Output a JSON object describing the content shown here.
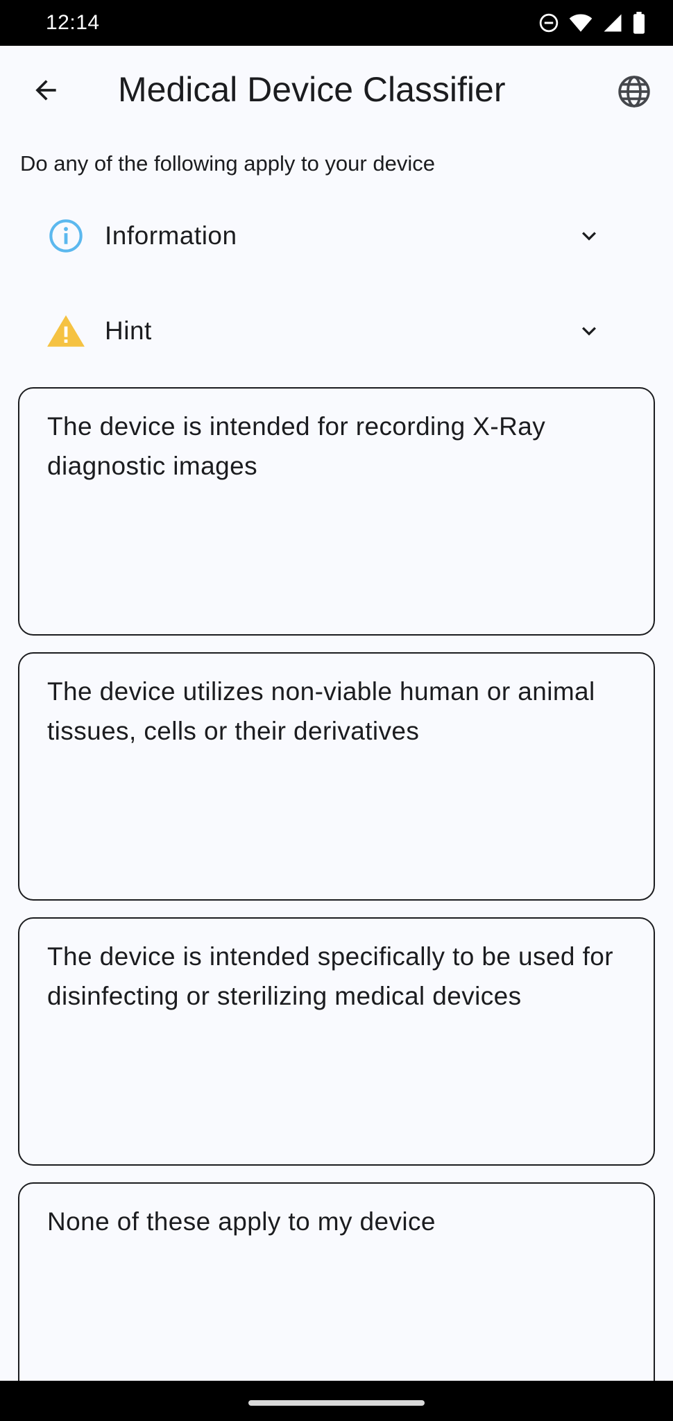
{
  "status_bar": {
    "time": "12:14",
    "icons": [
      "dnd-icon",
      "wifi-icon",
      "signal-icon",
      "battery-icon"
    ]
  },
  "app_bar": {
    "title": "Medical Device Classifier",
    "back_icon": "arrow-back-icon",
    "language_icon": "globe-icon"
  },
  "prompt": "Do any of the following apply to your device",
  "expanders": [
    {
      "label": "Information",
      "icon": "info-icon",
      "icon_color": "#5bb8ee"
    },
    {
      "label": "Hint",
      "icon": "warning-icon",
      "icon_color": "#f5c242"
    }
  ],
  "options": [
    {
      "text": "The device is intended for recording X-Ray diagnostic images"
    },
    {
      "text": "The device utilizes non-viable human or animal tissues, cells or their derivatives"
    },
    {
      "text": "The device is intended specifically to be used for disinfecting or sterilizing medical devices"
    },
    {
      "text": "None of these apply to my device"
    }
  ],
  "colors": {
    "background": "#f9fafe",
    "text": "#1b1c1f",
    "card_border": "#1b1c1f",
    "system_bars": "#000000"
  }
}
